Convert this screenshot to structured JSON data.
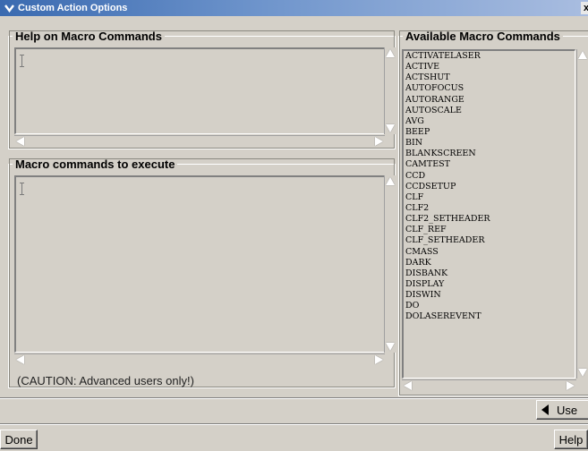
{
  "window": {
    "title": "Custom Action Options",
    "menu_icon": "chevron-down-icon",
    "close_icon": "close-icon",
    "close_glyph": "x"
  },
  "help_panel": {
    "legend": "Help on Macro Commands",
    "text": ""
  },
  "execute_panel": {
    "legend": "Macro commands to execute",
    "text": ""
  },
  "caution_text": "(CAUTION: Advanced users only!)",
  "available_panel": {
    "legend": "Available Macro Commands",
    "items": [
      "ACTIVATELASER",
      "ACTIVE",
      "ACTSHUT",
      "AUTOFOCUS",
      "AUTORANGE",
      "AUTOSCALE",
      "AVG",
      "BEEP",
      "BIN",
      "BLANKSCREEN",
      "CAMTEST",
      "CCD",
      "CCDSETUP",
      "CLF",
      "CLF2",
      "CLF2_SETHEADER",
      "CLF_REF",
      "CLF_SETHEADER",
      "CMASS",
      "DARK",
      "DISBANK",
      "DISPLAY",
      "DISWIN",
      "DO",
      "DOLASEREVENT"
    ]
  },
  "buttons": {
    "use_label": "Use",
    "done_label": "Done",
    "help_label": "Help"
  },
  "colors": {
    "window_bg": "#d4d0c8",
    "titlebar_start": "#3a6ab0",
    "titlebar_end": "#a9bde0"
  }
}
